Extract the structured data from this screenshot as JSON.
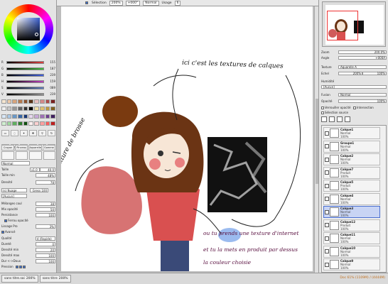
{
  "topbar": {
    "selection_label": "Sélection",
    "zoom": "200%",
    "rotation": "+000°",
    "blend": "Normal",
    "usage_label": "Usage",
    "usage_value": "6"
  },
  "color_sliders": [
    {
      "label": "R",
      "value": "155",
      "color": "#e04040"
    },
    {
      "label": "G",
      "value": "187",
      "color": "#40c040"
    },
    {
      "label": "B",
      "value": "239",
      "color": "#4060e0"
    },
    {
      "label": "H",
      "value": "159",
      "color": "#c040c0"
    },
    {
      "label": "S",
      "value": "089",
      "color": "#6080c0"
    },
    {
      "label": "V",
      "value": "239",
      "color": "#909090"
    }
  ],
  "palette": [
    "#f5e6d0",
    "#eec9a8",
    "#d9a57c",
    "#b57a4e",
    "#8a5230",
    "#5a3418",
    "#e8c0c0",
    "#d48a8a",
    "#b04a4a",
    "#7a2020",
    "#f0f0f0",
    "#c8c8c8",
    "#969696",
    "#646464",
    "#323232",
    "#000000",
    "#f2e0a8",
    "#e0c070",
    "#c09a40",
    "#806020",
    "#d8e8f8",
    "#a8c8e8",
    "#6898c8",
    "#3868a8",
    "#183878",
    "#e8d8f0",
    "#c8a8d8",
    "#a070b8",
    "#704090",
    "#402060",
    "#d0f0d0",
    "#a0d8a0",
    "#60b060",
    "#308030",
    "#105010",
    "#fff0f0",
    "#ffd0d0",
    "#ffa0a0",
    "#ff6060",
    "#c02020"
  ],
  "tool_tabs": [
    "Crayon",
    "Pinceau",
    "Aquarelle",
    "Gomme"
  ],
  "brush": {
    "mode": "Normal",
    "size_label": "Taille",
    "size_value": "x1.0",
    "size_px": "40.0",
    "min_size_label": "Taille min",
    "min_size_value": "48%",
    "density_label": "Densité",
    "density_value": "78",
    "shape": "(sans forme)",
    "texture": "(s) Nuage",
    "texture_amount": "Gress 100",
    "texture_none": "[Aucun]",
    "blend_label": "Mélanges coul",
    "blend_value": "38",
    "mix_label": "Mix opacité",
    "mix_value": "50",
    "persist_label": "Persistance",
    "persist_value": "100",
    "keep_opacity": "Ferrou opacité",
    "pro_label": "Lissage Pro",
    "pro_value": "3%",
    "advanced": "Avancé",
    "quality_label": "Qualité",
    "quality_value": "4 (Rapide)",
    "hardness_label": "Dureté",
    "hardness_value": "0",
    "min_density_label": "Densité min",
    "min_density_value": "20",
    "max_density_label": "Densité max",
    "max_density_value": "100",
    "pressure_label": "Dur <->Doux",
    "pressure_value": "100",
    "pressure_row": "Pression"
  },
  "annotations": {
    "top": "ici c'est les textures de calques",
    "left": "texture de brosse",
    "bottom_line1": "ou tu prends une texture d'internet",
    "bottom_line2": "et tu la mets en produit par dessus",
    "bottom_line3": "la couleur choisie"
  },
  "nav": {
    "zoom_label": "Zoom",
    "zoom_value": "200.0%",
    "angle_label": "Angle",
    "angle_value": "+000A"
  },
  "layer_props": {
    "texture_label": "Texture",
    "texture_value": "Aquarelle A",
    "scale_label": "Echel",
    "scale_value": "200%",
    "scale_pct": "100%",
    "humidity_label": "Humidité",
    "humidity_value": "[Aucun]",
    "fusion_label": "Fusion",
    "fusion_value": "Normal",
    "opacity_label": "Opacité",
    "opacity_value": "100%",
    "lock_opacity": "Verrouiller opacité",
    "intersect": "Intersection",
    "selection_source": "Sélection source"
  },
  "layers": [
    {
      "name": "Calque1",
      "mode": "Normal",
      "opacity": "100%"
    },
    {
      "name": "Groupe1",
      "mode": "Normal",
      "opacity": "100%"
    },
    {
      "name": "Calque2",
      "mode": "Normal",
      "opacity": "100%"
    },
    {
      "name": "Calque7",
      "mode": "Produit",
      "opacity": "100%"
    },
    {
      "name": "Calque5",
      "mode": "Produit",
      "opacity": "100%"
    },
    {
      "name": "Calque4",
      "mode": "Normal",
      "opacity": "100%"
    },
    {
      "name": "Calque3",
      "mode": "Normal",
      "opacity": "100%"
    },
    {
      "name": "Calque12",
      "mode": "Produit",
      "opacity": "100%"
    },
    {
      "name": "Calque11",
      "mode": "Normal",
      "opacity": "100%"
    },
    {
      "name": "Calque10",
      "mode": "Normal",
      "opacity": "100%"
    },
    {
      "name": "Calque9",
      "mode": "Normal",
      "opacity": "100%"
    }
  ],
  "status": {
    "file1": "sans titre.sai",
    "file1_zoom": "200%",
    "file2": "sans titre",
    "file2_zoom": "200%",
    "memory": "Doc 61% (1109M) / (4444M)"
  }
}
